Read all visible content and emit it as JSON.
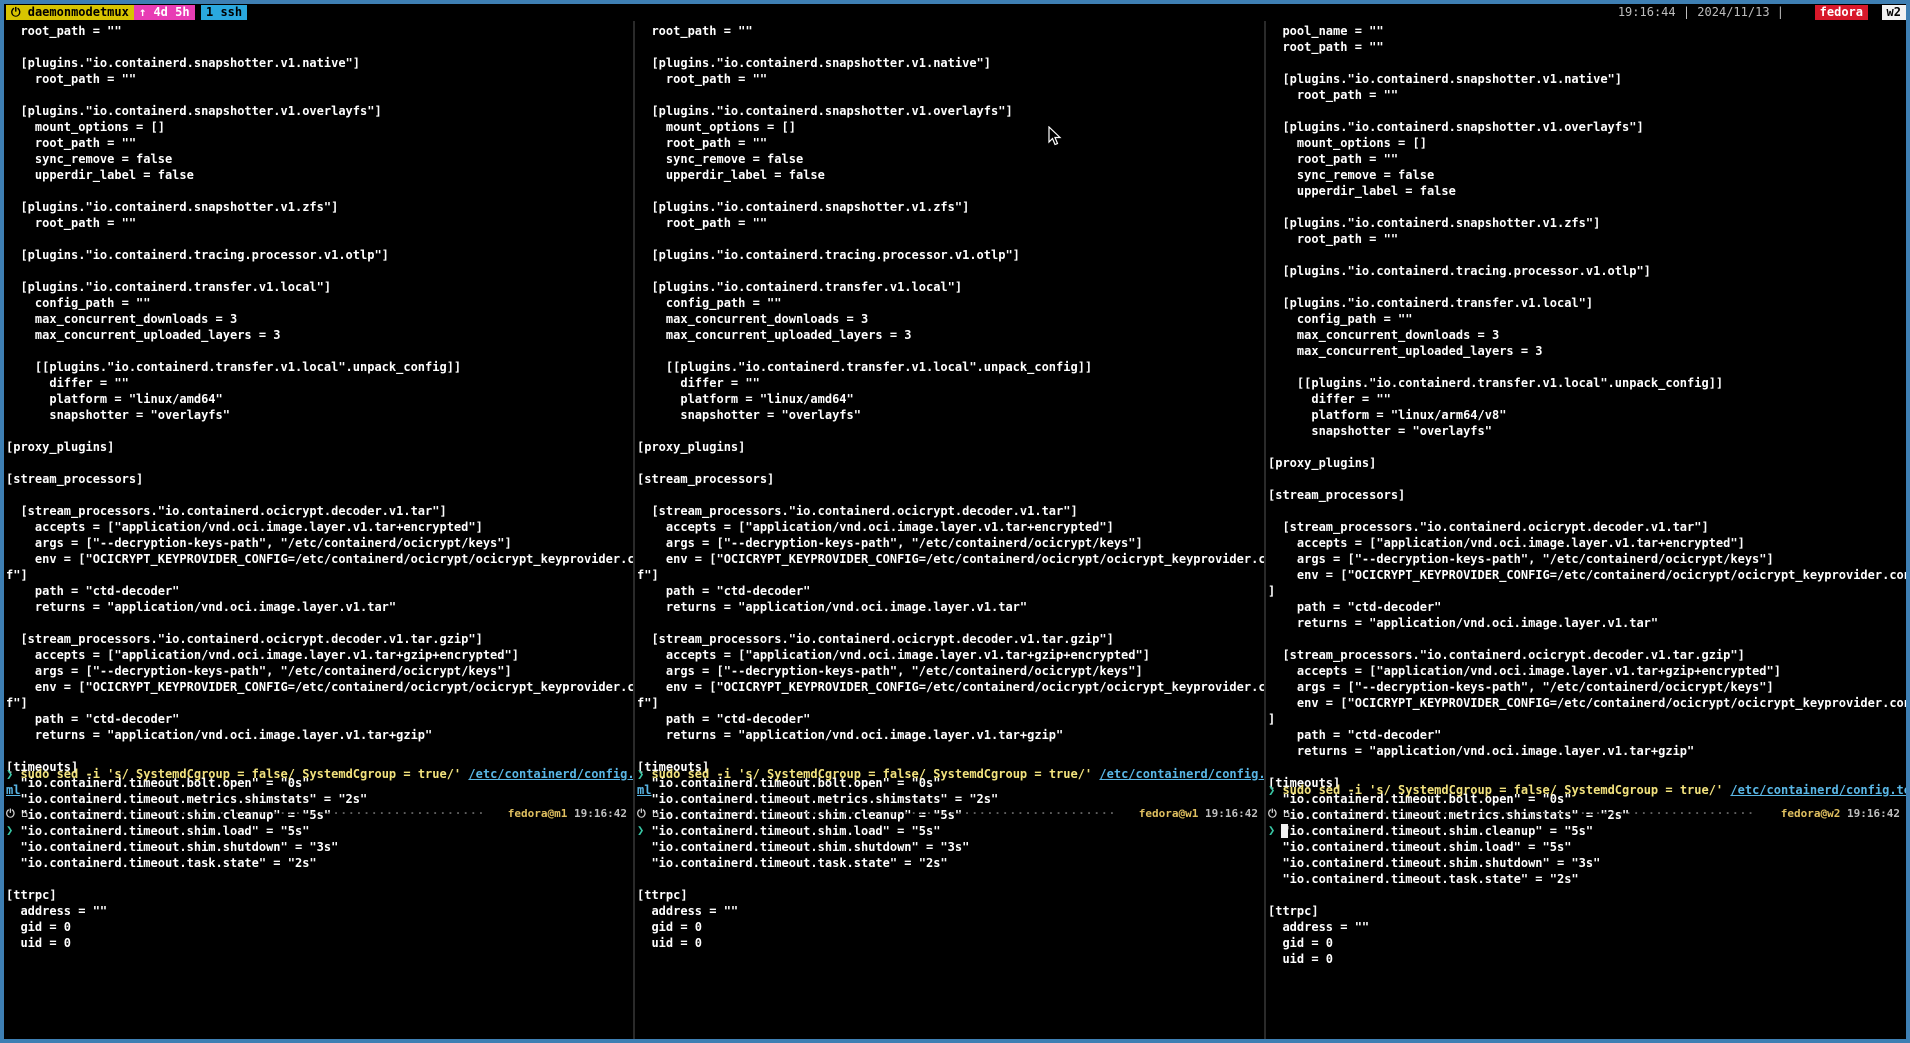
{
  "status_bar": {
    "session": "⏻ daemonmodetmux",
    "uptime": "↑ 4d 5h",
    "window": "1 ssh",
    "clock": "19:16:44 | 2024/11/13 |",
    "host": "fedora",
    "window_name": "w2"
  },
  "panes": [
    {
      "output": "  root_path = \"\"\n\n  [plugins.\"io.containerd.snapshotter.v1.native\"]\n    root_path = \"\"\n\n  [plugins.\"io.containerd.snapshotter.v1.overlayfs\"]\n    mount_options = []\n    root_path = \"\"\n    sync_remove = false\n    upperdir_label = false\n\n  [plugins.\"io.containerd.snapshotter.v1.zfs\"]\n    root_path = \"\"\n\n  [plugins.\"io.containerd.tracing.processor.v1.otlp\"]\n\n  [plugins.\"io.containerd.transfer.v1.local\"]\n    config_path = \"\"\n    max_concurrent_downloads = 3\n    max_concurrent_uploaded_layers = 3\n\n    [[plugins.\"io.containerd.transfer.v1.local\".unpack_config]]\n      differ = \"\"\n      platform = \"linux/amd64\"\n      snapshotter = \"overlayfs\"\n\n[proxy_plugins]\n\n[stream_processors]\n\n  [stream_processors.\"io.containerd.ocicrypt.decoder.v1.tar\"]\n    accepts = [\"application/vnd.oci.image.layer.v1.tar+encrypted\"]\n    args = [\"--decryption-keys-path\", \"/etc/containerd/ocicrypt/keys\"]\n    env = [\"OCICRYPT_KEYPROVIDER_CONFIG=/etc/containerd/ocicrypt/ocicrypt_keyprovider.con\nf\"]\n    path = \"ctd-decoder\"\n    returns = \"application/vnd.oci.image.layer.v1.tar\"\n\n  [stream_processors.\"io.containerd.ocicrypt.decoder.v1.tar.gzip\"]\n    accepts = [\"application/vnd.oci.image.layer.v1.tar+gzip+encrypted\"]\n    args = [\"--decryption-keys-path\", \"/etc/containerd/ocicrypt/keys\"]\n    env = [\"OCICRYPT_KEYPROVIDER_CONFIG=/etc/containerd/ocicrypt/ocicrypt_keyprovider.con\nf\"]\n    path = \"ctd-decoder\"\n    returns = \"application/vnd.oci.image.layer.v1.tar+gzip\"\n\n[timeouts]\n  \"io.containerd.timeout.bolt.open\" = \"0s\"\n  \"io.containerd.timeout.metrics.shimstats\" = \"2s\"\n  \"io.containerd.timeout.shim.cleanup\" = \"5s\"\n  \"io.containerd.timeout.shim.load\" = \"5s\"\n  \"io.containerd.timeout.shim.shutdown\" = \"3s\"\n  \"io.containerd.timeout.task.state\" = \"2s\"\n\n[ttrpc]\n  address = \"\"\n  gid = 0\n  uid = 0",
      "cmd_arrow": "❯",
      "cmd": " sudo sed -i 's/ SystemdCgroup = false/ SystemdCgroup = true/' ",
      "cmd_path": "/etc/containerd/config.to",
      "cmd_path_wrap": "ml",
      "prompt_icon": "⏻ ⌂ ~",
      "prompt_user": "fedora@m1",
      "prompt_time": "19:16:42",
      "prompt_char": "❯"
    },
    {
      "output": "  root_path = \"\"\n\n  [plugins.\"io.containerd.snapshotter.v1.native\"]\n    root_path = \"\"\n\n  [plugins.\"io.containerd.snapshotter.v1.overlayfs\"]\n    mount_options = []\n    root_path = \"\"\n    sync_remove = false\n    upperdir_label = false\n\n  [plugins.\"io.containerd.snapshotter.v1.zfs\"]\n    root_path = \"\"\n\n  [plugins.\"io.containerd.tracing.processor.v1.otlp\"]\n\n  [plugins.\"io.containerd.transfer.v1.local\"]\n    config_path = \"\"\n    max_concurrent_downloads = 3\n    max_concurrent_uploaded_layers = 3\n\n    [[plugins.\"io.containerd.transfer.v1.local\".unpack_config]]\n      differ = \"\"\n      platform = \"linux/amd64\"\n      snapshotter = \"overlayfs\"\n\n[proxy_plugins]\n\n[stream_processors]\n\n  [stream_processors.\"io.containerd.ocicrypt.decoder.v1.tar\"]\n    accepts = [\"application/vnd.oci.image.layer.v1.tar+encrypted\"]\n    args = [\"--decryption-keys-path\", \"/etc/containerd/ocicrypt/keys\"]\n    env = [\"OCICRYPT_KEYPROVIDER_CONFIG=/etc/containerd/ocicrypt/ocicrypt_keyprovider.con\nf\"]\n    path = \"ctd-decoder\"\n    returns = \"application/vnd.oci.image.layer.v1.tar\"\n\n  [stream_processors.\"io.containerd.ocicrypt.decoder.v1.tar.gzip\"]\n    accepts = [\"application/vnd.oci.image.layer.v1.tar+gzip+encrypted\"]\n    args = [\"--decryption-keys-path\", \"/etc/containerd/ocicrypt/keys\"]\n    env = [\"OCICRYPT_KEYPROVIDER_CONFIG=/etc/containerd/ocicrypt/ocicrypt_keyprovider.con\nf\"]\n    path = \"ctd-decoder\"\n    returns = \"application/vnd.oci.image.layer.v1.tar+gzip\"\n\n[timeouts]\n  \"io.containerd.timeout.bolt.open\" = \"0s\"\n  \"io.containerd.timeout.metrics.shimstats\" = \"2s\"\n  \"io.containerd.timeout.shim.cleanup\" = \"5s\"\n  \"io.containerd.timeout.shim.load\" = \"5s\"\n  \"io.containerd.timeout.shim.shutdown\" = \"3s\"\n  \"io.containerd.timeout.task.state\" = \"2s\"\n\n[ttrpc]\n  address = \"\"\n  gid = 0\n  uid = 0",
      "cmd_arrow": "❯",
      "cmd": " sudo sed -i 's/ SystemdCgroup = false/ SystemdCgroup = true/' ",
      "cmd_path": "/etc/containerd/config.to",
      "cmd_path_wrap": "ml",
      "prompt_icon": "⏻ ⌂ ~",
      "prompt_user": "fedora@w1",
      "prompt_time": "19:16:42",
      "prompt_char": "❯"
    },
    {
      "output": "  pool_name = \"\"\n  root_path = \"\"\n\n  [plugins.\"io.containerd.snapshotter.v1.native\"]\n    root_path = \"\"\n\n  [plugins.\"io.containerd.snapshotter.v1.overlayfs\"]\n    mount_options = []\n    root_path = \"\"\n    sync_remove = false\n    upperdir_label = false\n\n  [plugins.\"io.containerd.snapshotter.v1.zfs\"]\n    root_path = \"\"\n\n  [plugins.\"io.containerd.tracing.processor.v1.otlp\"]\n\n  [plugins.\"io.containerd.transfer.v1.local\"]\n    config_path = \"\"\n    max_concurrent_downloads = 3\n    max_concurrent_uploaded_layers = 3\n\n    [[plugins.\"io.containerd.transfer.v1.local\".unpack_config]]\n      differ = \"\"\n      platform = \"linux/arm64/v8\"\n      snapshotter = \"overlayfs\"\n\n[proxy_plugins]\n\n[stream_processors]\n\n  [stream_processors.\"io.containerd.ocicrypt.decoder.v1.tar\"]\n    accepts = [\"application/vnd.oci.image.layer.v1.tar+encrypted\"]\n    args = [\"--decryption-keys-path\", \"/etc/containerd/ocicrypt/keys\"]\n    env = [\"OCICRYPT_KEYPROVIDER_CONFIG=/etc/containerd/ocicrypt/ocicrypt_keyprovider.conf\"\n]\n    path = \"ctd-decoder\"\n    returns = \"application/vnd.oci.image.layer.v1.tar\"\n\n  [stream_processors.\"io.containerd.ocicrypt.decoder.v1.tar.gzip\"]\n    accepts = [\"application/vnd.oci.image.layer.v1.tar+gzip+encrypted\"]\n    args = [\"--decryption-keys-path\", \"/etc/containerd/ocicrypt/keys\"]\n    env = [\"OCICRYPT_KEYPROVIDER_CONFIG=/etc/containerd/ocicrypt/ocicrypt_keyprovider.conf\"\n]\n    path = \"ctd-decoder\"\n    returns = \"application/vnd.oci.image.layer.v1.tar+gzip\"\n\n[timeouts]\n  \"io.containerd.timeout.bolt.open\" = \"0s\"\n  \"io.containerd.timeout.metrics.shimstats\" = \"2s\"\n  \"io.containerd.timeout.shim.cleanup\" = \"5s\"\n  \"io.containerd.timeout.shim.load\" = \"5s\"\n  \"io.containerd.timeout.shim.shutdown\" = \"3s\"\n  \"io.containerd.timeout.task.state\" = \"2s\"\n\n[ttrpc]\n  address = \"\"\n  gid = 0\n  uid = 0",
      "cmd_arrow": "❯",
      "cmd": " sudo sed -i 's/ SystemdCgroup = false/ SystemdCgroup = true/' ",
      "cmd_path": "/etc/containerd/config.toml",
      "cmd_path_wrap": "",
      "prompt_icon": "⏻ ⌂ ~",
      "prompt_user": "fedora@w2",
      "prompt_time": "19:16:42",
      "prompt_char": "❯"
    }
  ],
  "icons": {
    "mouse": "mouse-pointer-icon"
  }
}
